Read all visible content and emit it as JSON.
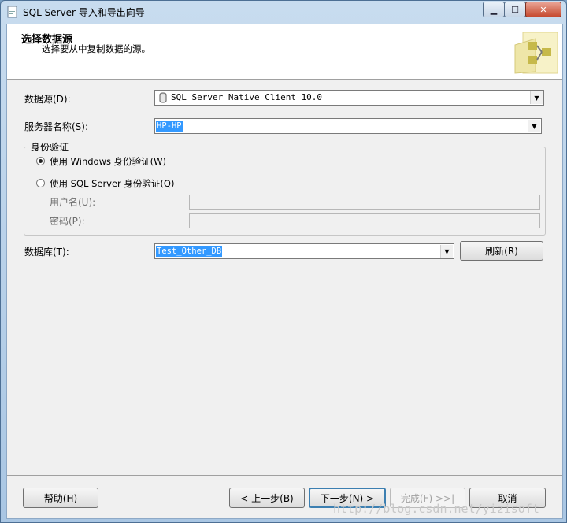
{
  "window": {
    "title": "SQL Server 导入和导出向导"
  },
  "header": {
    "title": "选择数据源",
    "subtitle": "选择要从中复制数据的源。"
  },
  "form": {
    "data_source_label": "数据源(D):",
    "data_source_value": "SQL Server Native Client 10.0",
    "server_label": "服务器名称(S):",
    "server_value": "HP-HP",
    "auth_group_label": "身份验证",
    "auth_windows_label": "使用 Windows 身份验证(W)",
    "auth_sql_label": "使用 SQL Server 身份验证(Q)",
    "auth_selected": "windows",
    "username_label": "用户名(U):",
    "username_value": "",
    "password_label": "密码(P):",
    "password_value": "",
    "database_label": "数据库(T):",
    "database_value": "Test_Other_DB",
    "refresh_label": "刷新(R)"
  },
  "footer": {
    "help_label": "帮助(H)",
    "back_label": "< 上一步(B)",
    "next_label": "下一步(N) >",
    "finish_label": "完成(F) >>|",
    "cancel_label": "取消"
  },
  "watermark": "http://blog.csdn.net/yizisoft"
}
